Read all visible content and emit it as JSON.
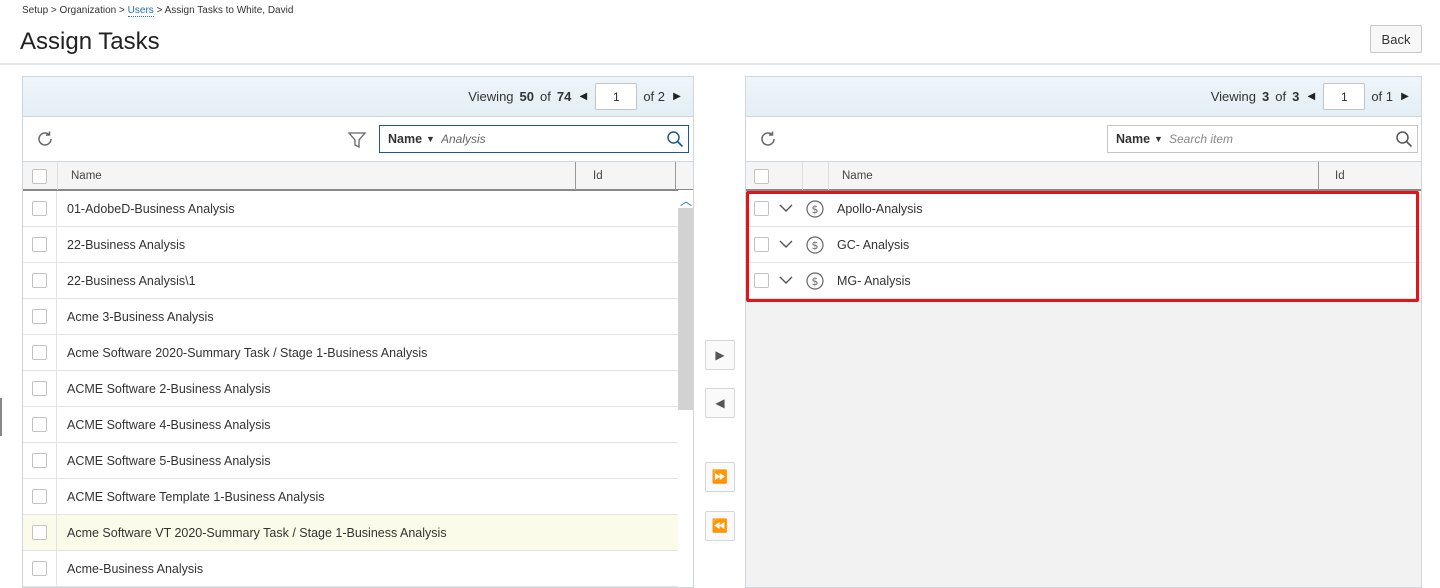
{
  "breadcrumb": {
    "setup": "Setup",
    "sep1": ">",
    "organization": "Organization",
    "sep2": ">",
    "users": "Users",
    "sep3": ">",
    "current": "Assign Tasks to White, David"
  },
  "page_title": "Assign Tasks",
  "back_label": "Back",
  "left_panel": {
    "viewing_label": "Viewing",
    "viewing_count": "50",
    "of_label": "of",
    "total": "74",
    "page_value": "1",
    "of_pages_label": "of 2",
    "search_field": "Name",
    "search_value": "Analysis",
    "col_name": "Name",
    "col_id": "Id",
    "rows": [
      "01-AdobeD-Business Analysis",
      "22-Business Analysis",
      "22-Business Analysis\\1",
      "Acme 3-Business Analysis",
      "Acme Software 2020-Summary Task / Stage 1-Business Analysis",
      "ACME Software 2-Business Analysis",
      "ACME Software 4-Business Analysis",
      "ACME Software 5-Business Analysis",
      "ACME Software Template 1-Business Analysis",
      "Acme Software VT 2020-Summary Task / Stage 1-Business Analysis",
      "Acme-Business Analysis"
    ],
    "highlighted_row": "Acme Software VT 2020-Summary Task / Stage 1-Business Analysis"
  },
  "right_panel": {
    "viewing_label": "Viewing",
    "viewing_count": "3",
    "of_label": "of",
    "total": "3",
    "page_value": "1",
    "of_pages_label": "of 1",
    "search_field": "Name",
    "search_placeholder": "Search item",
    "col_name": "Name",
    "col_id": "Id",
    "rows": [
      "Apollo-Analysis",
      "GC- Analysis",
      "MG- Analysis"
    ]
  },
  "transfer_buttons": [
    "move-right",
    "move-left",
    "move-all-right",
    "move-all-left"
  ],
  "colors": {
    "accent_blue": "#1c5a8a",
    "link_blue": "#2a6ebb",
    "highlight_red": "#e0141b",
    "row_highlight": "#fbfbe9"
  }
}
